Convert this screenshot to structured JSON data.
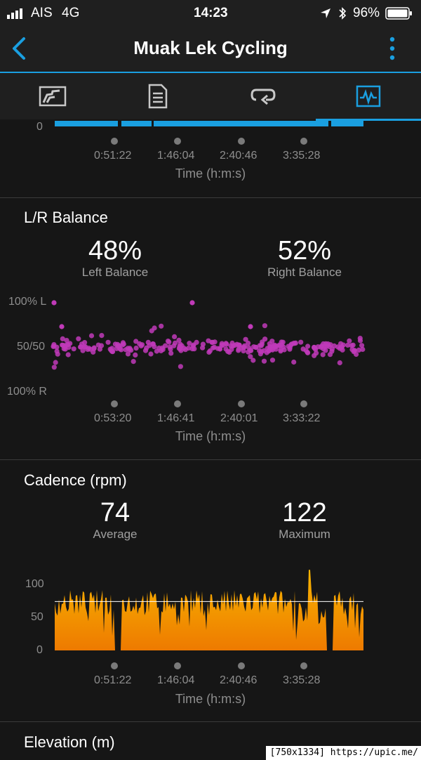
{
  "status_bar": {
    "carrier": "AIS",
    "network": "4G",
    "time": "14:23",
    "battery": "96%"
  },
  "nav": {
    "title": "Muak Lek Cycling"
  },
  "tabs": [
    {
      "name": "overview-tab",
      "icon": "overview-chart-icon"
    },
    {
      "name": "details-tab",
      "icon": "document-icon"
    },
    {
      "name": "laps-tab",
      "icon": "laps-icon"
    },
    {
      "name": "charts-tab",
      "icon": "charts-icon",
      "active": true
    }
  ],
  "colors": {
    "accent": "#1a9fe0",
    "balance": "#c03ab8",
    "cadence": "#f5a000",
    "background": "#161616"
  },
  "top_chart": {
    "y_tick": "0",
    "x_ticks": [
      "0:51:22",
      "1:46:04",
      "2:40:46",
      "3:35:28"
    ],
    "x_label": "Time (h:m:s)"
  },
  "balance": {
    "title": "L/R Balance",
    "left_value": "48%",
    "left_label": "Left Balance",
    "right_value": "52%",
    "right_label": "Right Balance",
    "y_ticks": [
      "100% L",
      "50/50",
      "100% R"
    ],
    "x_ticks": [
      "0:53:20",
      "1:46:41",
      "2:40:01",
      "3:33:22"
    ],
    "x_label": "Time (h:m:s)"
  },
  "cadence": {
    "title": "Cadence (rpm)",
    "avg_value": "74",
    "avg_label": "Average",
    "max_value": "122",
    "max_label": "Maximum",
    "y_ticks": [
      "100",
      "50",
      "0"
    ],
    "x_ticks": [
      "0:51:22",
      "1:46:04",
      "2:40:46",
      "3:35:28"
    ],
    "x_label": "Time (h:m:s)"
  },
  "elevation": {
    "title": "Elevation (m)"
  },
  "watermark": "[750x1334] https://upic.me/"
}
